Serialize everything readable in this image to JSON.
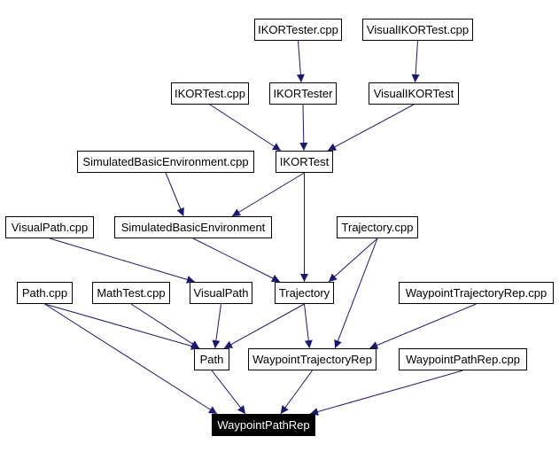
{
  "diagram": {
    "edge_color": "#191970",
    "nodes": [
      {
        "id": "ikortester_cpp",
        "label": "IKORTester.cpp"
      },
      {
        "id": "visualikortest_cpp",
        "label": "VisualIKORTest.cpp"
      },
      {
        "id": "ikortest_cpp",
        "label": "IKORTest.cpp"
      },
      {
        "id": "ikortester",
        "label": "IKORTester"
      },
      {
        "id": "visualikortest",
        "label": "VisualIKORTest"
      },
      {
        "id": "simbasicenv_cpp",
        "label": "SimulatedBasicEnvironment.cpp"
      },
      {
        "id": "ikortest",
        "label": "IKORTest"
      },
      {
        "id": "visualpath_cpp",
        "label": "VisualPath.cpp"
      },
      {
        "id": "simbasicenv",
        "label": "SimulatedBasicEnvironment"
      },
      {
        "id": "trajectory_cpp",
        "label": "Trajectory.cpp"
      },
      {
        "id": "path_cpp",
        "label": "Path.cpp"
      },
      {
        "id": "mathtest_cpp",
        "label": "MathTest.cpp"
      },
      {
        "id": "visualpath",
        "label": "VisualPath"
      },
      {
        "id": "trajectory",
        "label": "Trajectory"
      },
      {
        "id": "waypointtrajrep_cpp",
        "label": "WaypointTrajectoryRep.cpp"
      },
      {
        "id": "path",
        "label": "Path"
      },
      {
        "id": "waypointtrajrep",
        "label": "WaypointTrajectoryRep"
      },
      {
        "id": "waypointpathrep_cpp",
        "label": "WaypointPathRep.cpp"
      },
      {
        "id": "waypointpathrep",
        "label": "WaypointPathRep",
        "highlighted": true
      }
    ],
    "edges": [
      [
        "ikortester_cpp",
        "ikortester"
      ],
      [
        "visualikortest_cpp",
        "visualikortest"
      ],
      [
        "ikortest_cpp",
        "ikortest"
      ],
      [
        "ikortester",
        "ikortest"
      ],
      [
        "visualikortest",
        "ikortest"
      ],
      [
        "simbasicenv_cpp",
        "simbasicenv"
      ],
      [
        "ikortest",
        "simbasicenv"
      ],
      [
        "ikortest",
        "trajectory"
      ],
      [
        "visualpath_cpp",
        "visualpath"
      ],
      [
        "simbasicenv",
        "trajectory"
      ],
      [
        "trajectory_cpp",
        "trajectory"
      ],
      [
        "trajectory_cpp",
        "waypointtrajrep"
      ],
      [
        "path_cpp",
        "path"
      ],
      [
        "path_cpp",
        "waypointpathrep"
      ],
      [
        "mathtest_cpp",
        "path"
      ],
      [
        "visualpath",
        "path"
      ],
      [
        "trajectory",
        "path"
      ],
      [
        "trajectory",
        "waypointtrajrep"
      ],
      [
        "waypointtrajrep_cpp",
        "waypointtrajrep"
      ],
      [
        "path",
        "waypointpathrep"
      ],
      [
        "waypointtrajrep",
        "waypointpathrep"
      ],
      [
        "waypointpathrep_cpp",
        "waypointpathrep"
      ]
    ]
  }
}
